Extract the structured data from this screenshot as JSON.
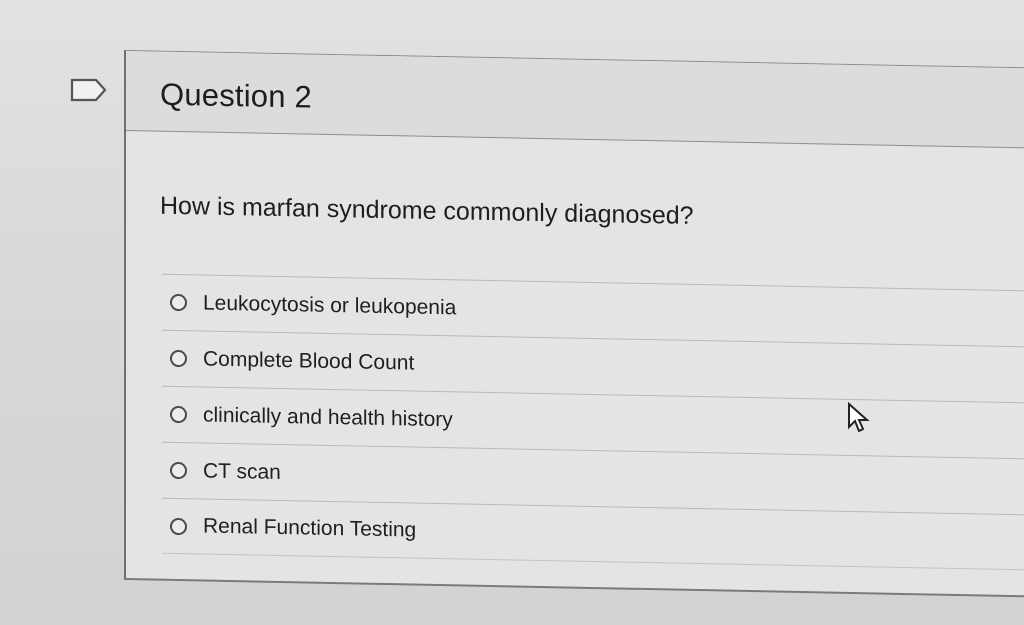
{
  "question": {
    "title": "Question 2",
    "text": "How is marfan syndrome commonly diagnosed?",
    "options": [
      {
        "label": "Leukocytosis or leukopenia",
        "selected": false
      },
      {
        "label": "Complete Blood Count",
        "selected": false
      },
      {
        "label": "clinically and health history",
        "selected": false
      },
      {
        "label": "CT scan",
        "selected": false
      },
      {
        "label": "Renal Function Testing",
        "selected": false
      }
    ]
  },
  "icons": {
    "flag": "flag-icon",
    "cursor": "mouse-pointer-icon",
    "radio": "radio-unselected-icon"
  },
  "colors": {
    "text": "#1e1e20",
    "border": "#707072",
    "background": "#dadadc"
  }
}
